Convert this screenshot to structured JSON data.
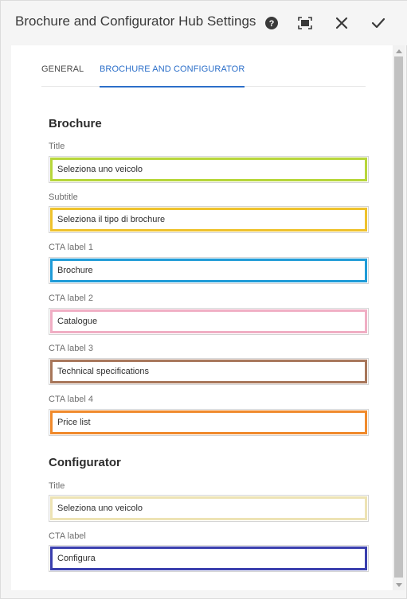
{
  "dialog": {
    "title": "Brochure and Configurator Hub Settings",
    "buttons": {
      "help": "help-icon",
      "fullscreen": "fullscreen-icon",
      "close": "close-icon",
      "confirm": "checkmark-icon"
    }
  },
  "tabs": [
    {
      "label": "GENERAL",
      "active": false
    },
    {
      "label": "BROCHURE AND CONFIGURATOR",
      "active": true
    }
  ],
  "brochure": {
    "title": "Brochure",
    "fields": [
      {
        "label": "Title",
        "value": "Seleziona uno veicolo",
        "border_color": "#b7d63a"
      },
      {
        "label": "Subtitle",
        "value": "Seleziona il tipo di brochure",
        "border_color": "#eec22c"
      },
      {
        "label": "CTA label 1",
        "value": "Brochure",
        "border_color": "#1f9bd7"
      },
      {
        "label": "CTA label 2",
        "value": "Catalogue",
        "border_color": "#f0aec4"
      },
      {
        "label": "CTA label 3",
        "value": "Technical specifications",
        "border_color": "#a7765a"
      },
      {
        "label": "CTA label 4",
        "value": "Price list",
        "border_color": "#f08a2c"
      }
    ]
  },
  "configurator": {
    "title": "Configurator",
    "fields": [
      {
        "label": "Title",
        "value": "Seleziona uno veicolo",
        "border_color": "#ede3b4"
      },
      {
        "label": "CTA label",
        "value": "Configura",
        "border_color": "#3a3fae"
      }
    ]
  },
  "colors": {
    "accent": "#2c6fc9"
  }
}
